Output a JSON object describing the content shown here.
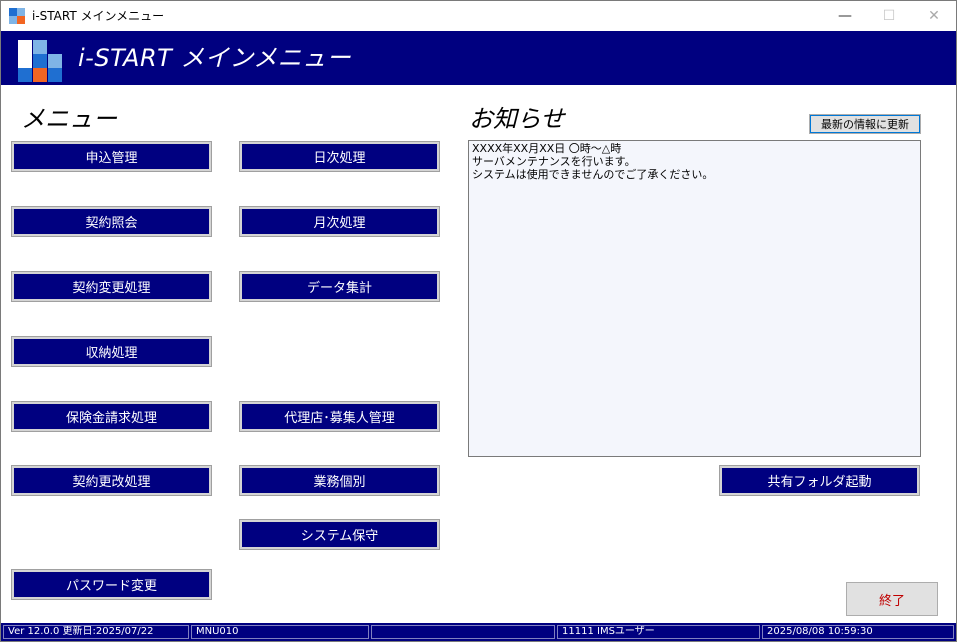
{
  "window": {
    "title": "i-START メインメニュー",
    "controls": {
      "minimize": "—",
      "maximize": "☐",
      "close": "✕"
    }
  },
  "header": {
    "title": "i-START メインメニュー"
  },
  "menu": {
    "title": "メニュー",
    "buttons": {
      "application_management": "申込管理",
      "daily_processing": "日次処理",
      "contract_inquiry": "契約照会",
      "monthly_processing": "月次処理",
      "contract_change": "契約変更処理",
      "data_aggregation": "データ集計",
      "premium_collection": "収納処理",
      "claim_processing": "保険金請求処理",
      "agency_management": "代理店･募集人管理",
      "contract_renewal": "契約更改処理",
      "business_individual": "業務個別",
      "system_maintenance": "システム保守",
      "password_change": "パスワード変更"
    }
  },
  "news": {
    "title": "お知らせ",
    "refresh_label": "最新の情報に更新",
    "lines": [
      "XXXX年XX月XX日 〇時～△時",
      "サーバメンテナンスを行います。",
      "システムは使用できませんのでご了承ください。"
    ],
    "shared_folder_label": "共有フォルダ起動"
  },
  "exit_label": "終了",
  "status": {
    "version": "Ver 12.0.0 更新日:2025/07/22",
    "screen_id": "MNU010",
    "blank": "",
    "user": "11111 IMSユーザー",
    "datetime": "2025/08/08 10:59:30"
  },
  "colors": {
    "navy": "#000080",
    "white": "#ffffff",
    "exit_text": "#c00000",
    "logo_light_blue": "#7fb4e6",
    "logo_blue": "#1f6fd1",
    "logo_orange": "#f26522"
  }
}
